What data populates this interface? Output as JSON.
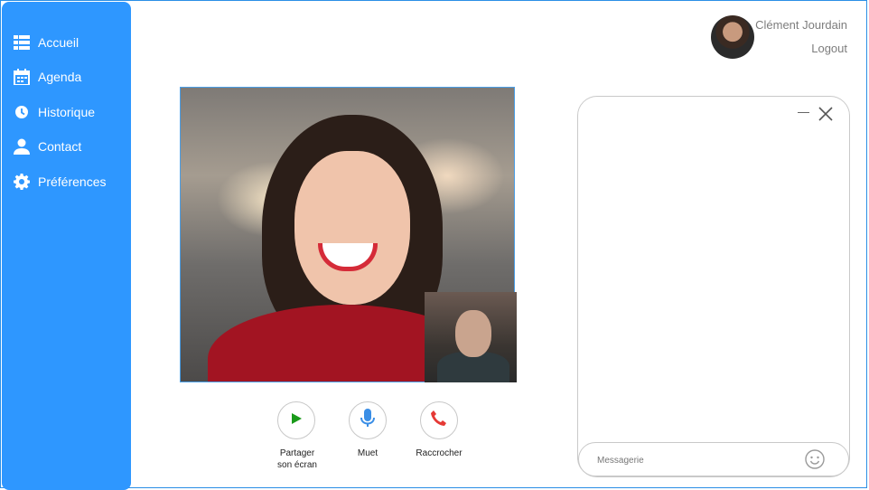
{
  "sidebar": {
    "items": [
      {
        "label": "Accueil",
        "icon": "home-list-icon"
      },
      {
        "label": "Agenda",
        "icon": "calendar-icon"
      },
      {
        "label": "Historique",
        "icon": "clock-icon"
      },
      {
        "label": "Contact",
        "icon": "person-icon"
      },
      {
        "label": "Préférences",
        "icon": "gear-icon"
      }
    ],
    "color": "#2e97ff"
  },
  "user": {
    "name": "Clément Jourdain",
    "logout_label": "Logout"
  },
  "controls": {
    "share": {
      "line1": "Partager",
      "line2": "son écran",
      "color": "#1a9a1a"
    },
    "mute": {
      "label": "Muet",
      "color": "#3a8ee6"
    },
    "hangup": {
      "label": "Raccrocher",
      "color": "#e53935"
    }
  },
  "chat": {
    "placeholder": "Messagerie"
  }
}
